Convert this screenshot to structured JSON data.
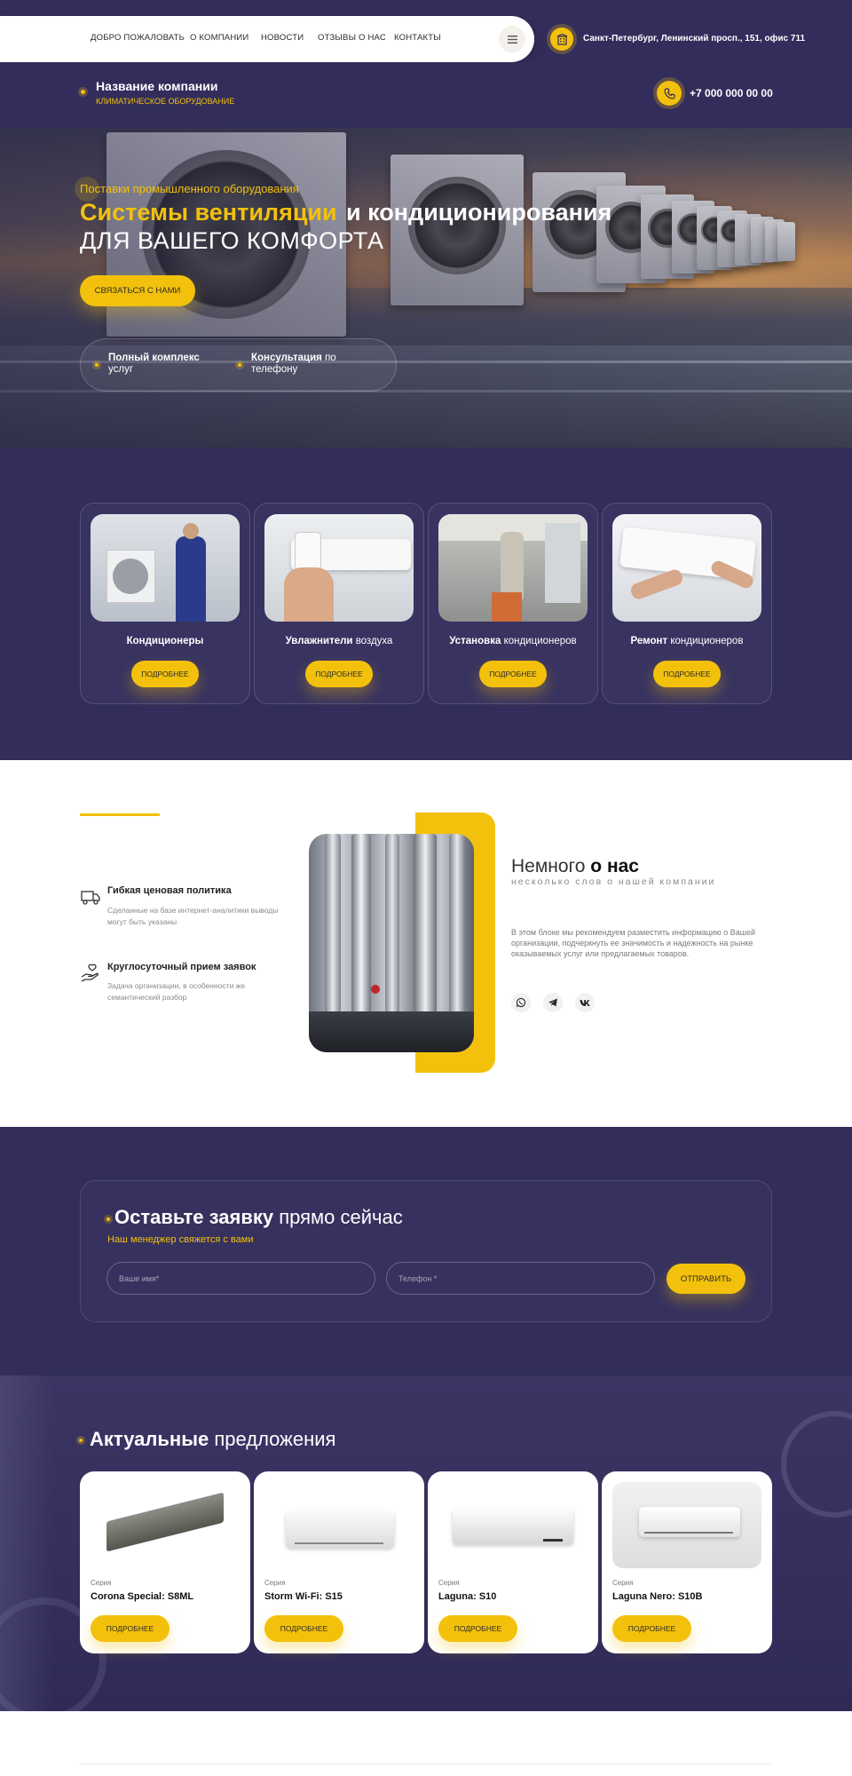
{
  "nav": {
    "items": [
      "ДОБРО ПОЖАЛОВАТЬ",
      "О КОМПАНИИ",
      "НОВОСТИ",
      "ОТЗЫВЫ О НАС",
      "КОНТАКТЫ"
    ],
    "address": "Санкт-Петербург, Ленинский просп., 151, офис 711",
    "menu_icon": "hamburger-icon",
    "address_icon": "building-icon"
  },
  "header": {
    "company_name": "Название компании",
    "company_sub": "КЛИМАТИЧЕСКОЕ ОБОРУДОВАНИЕ",
    "phone": "+7 000 000 00 00",
    "phone_icon": "phone-icon"
  },
  "hero": {
    "pretitle": "Поставки промышленного оборудования",
    "title_accent": "Системы вентиляции",
    "title_rest": "и кондиционирования",
    "title_line2": "ДЛЯ ВАШЕГО КОМФОРТА",
    "cta": "СВЯЗАТЬСЯ С НАМИ",
    "features": [
      {
        "bold": "Полный комплекс",
        "rest": "услуг"
      },
      {
        "bold": "Консультация",
        "rest": "по телефону"
      }
    ]
  },
  "services": [
    {
      "bold": "Кондиционеры",
      "rest": "",
      "button": "ПОДРОБНЕЕ"
    },
    {
      "bold": "Увлажнители",
      "rest": "воздуха",
      "button": "ПОДРОБНЕЕ"
    },
    {
      "bold": "Установка",
      "rest": "кондиционеров",
      "button": "ПОДРОБНЕЕ"
    },
    {
      "bold": "Ремонт",
      "rest": "кондиционеров",
      "button": "ПОДРОБНЕЕ"
    }
  ],
  "about": {
    "title_light": "Немного",
    "title_bold": "о нас",
    "subtitle": "несколько слов о нашей компании",
    "text": "В этом блоке мы рекомендуем разместить информацию о Вашей организации, подчеркнуть ее значимость и надежность на рынке оказываемых услуг или предлагаемых товаров.",
    "features": [
      {
        "title": "Гибкая ценовая политика",
        "desc": "Сделанные на базе интернет-аналитики выводы могут быть указаны",
        "icon": "truck-icon"
      },
      {
        "title": "Круглосуточный прием заявок",
        "desc": "Задача организации, в особенности же семантический разбор",
        "icon": "hand-heart-icon"
      }
    ],
    "social": [
      "whatsapp-icon",
      "telegram-icon",
      "vk-icon"
    ]
  },
  "form": {
    "title_bold": "Оставьте заявку",
    "title_light": "прямо сейчас",
    "subtitle": "Наш менеджер свяжется с вами",
    "name_placeholder": "Ваше имя*",
    "phone_placeholder": "Телефон *",
    "submit": "ОТПРАВИТЬ"
  },
  "offers": {
    "title_bold": "Актуальные",
    "title_light": "предложения",
    "items": [
      {
        "series": "Серия",
        "name": "Corona Special: S8ML",
        "button": "ПОДРОБНЕЕ"
      },
      {
        "series": "Серия",
        "name": "Storm Wi-Fi: S15",
        "button": "ПОДРОБНЕЕ"
      },
      {
        "series": "Серия",
        "name": "Laguna: S10",
        "button": "ПОДРОБНЕЕ"
      },
      {
        "series": "Серия",
        "name": "Laguna Nero: S10B",
        "button": "ПОДРОБНЕЕ"
      }
    ]
  },
  "colors": {
    "accent": "#f3c10c",
    "bg_dark": "#322d5b",
    "white": "#ffffff"
  }
}
